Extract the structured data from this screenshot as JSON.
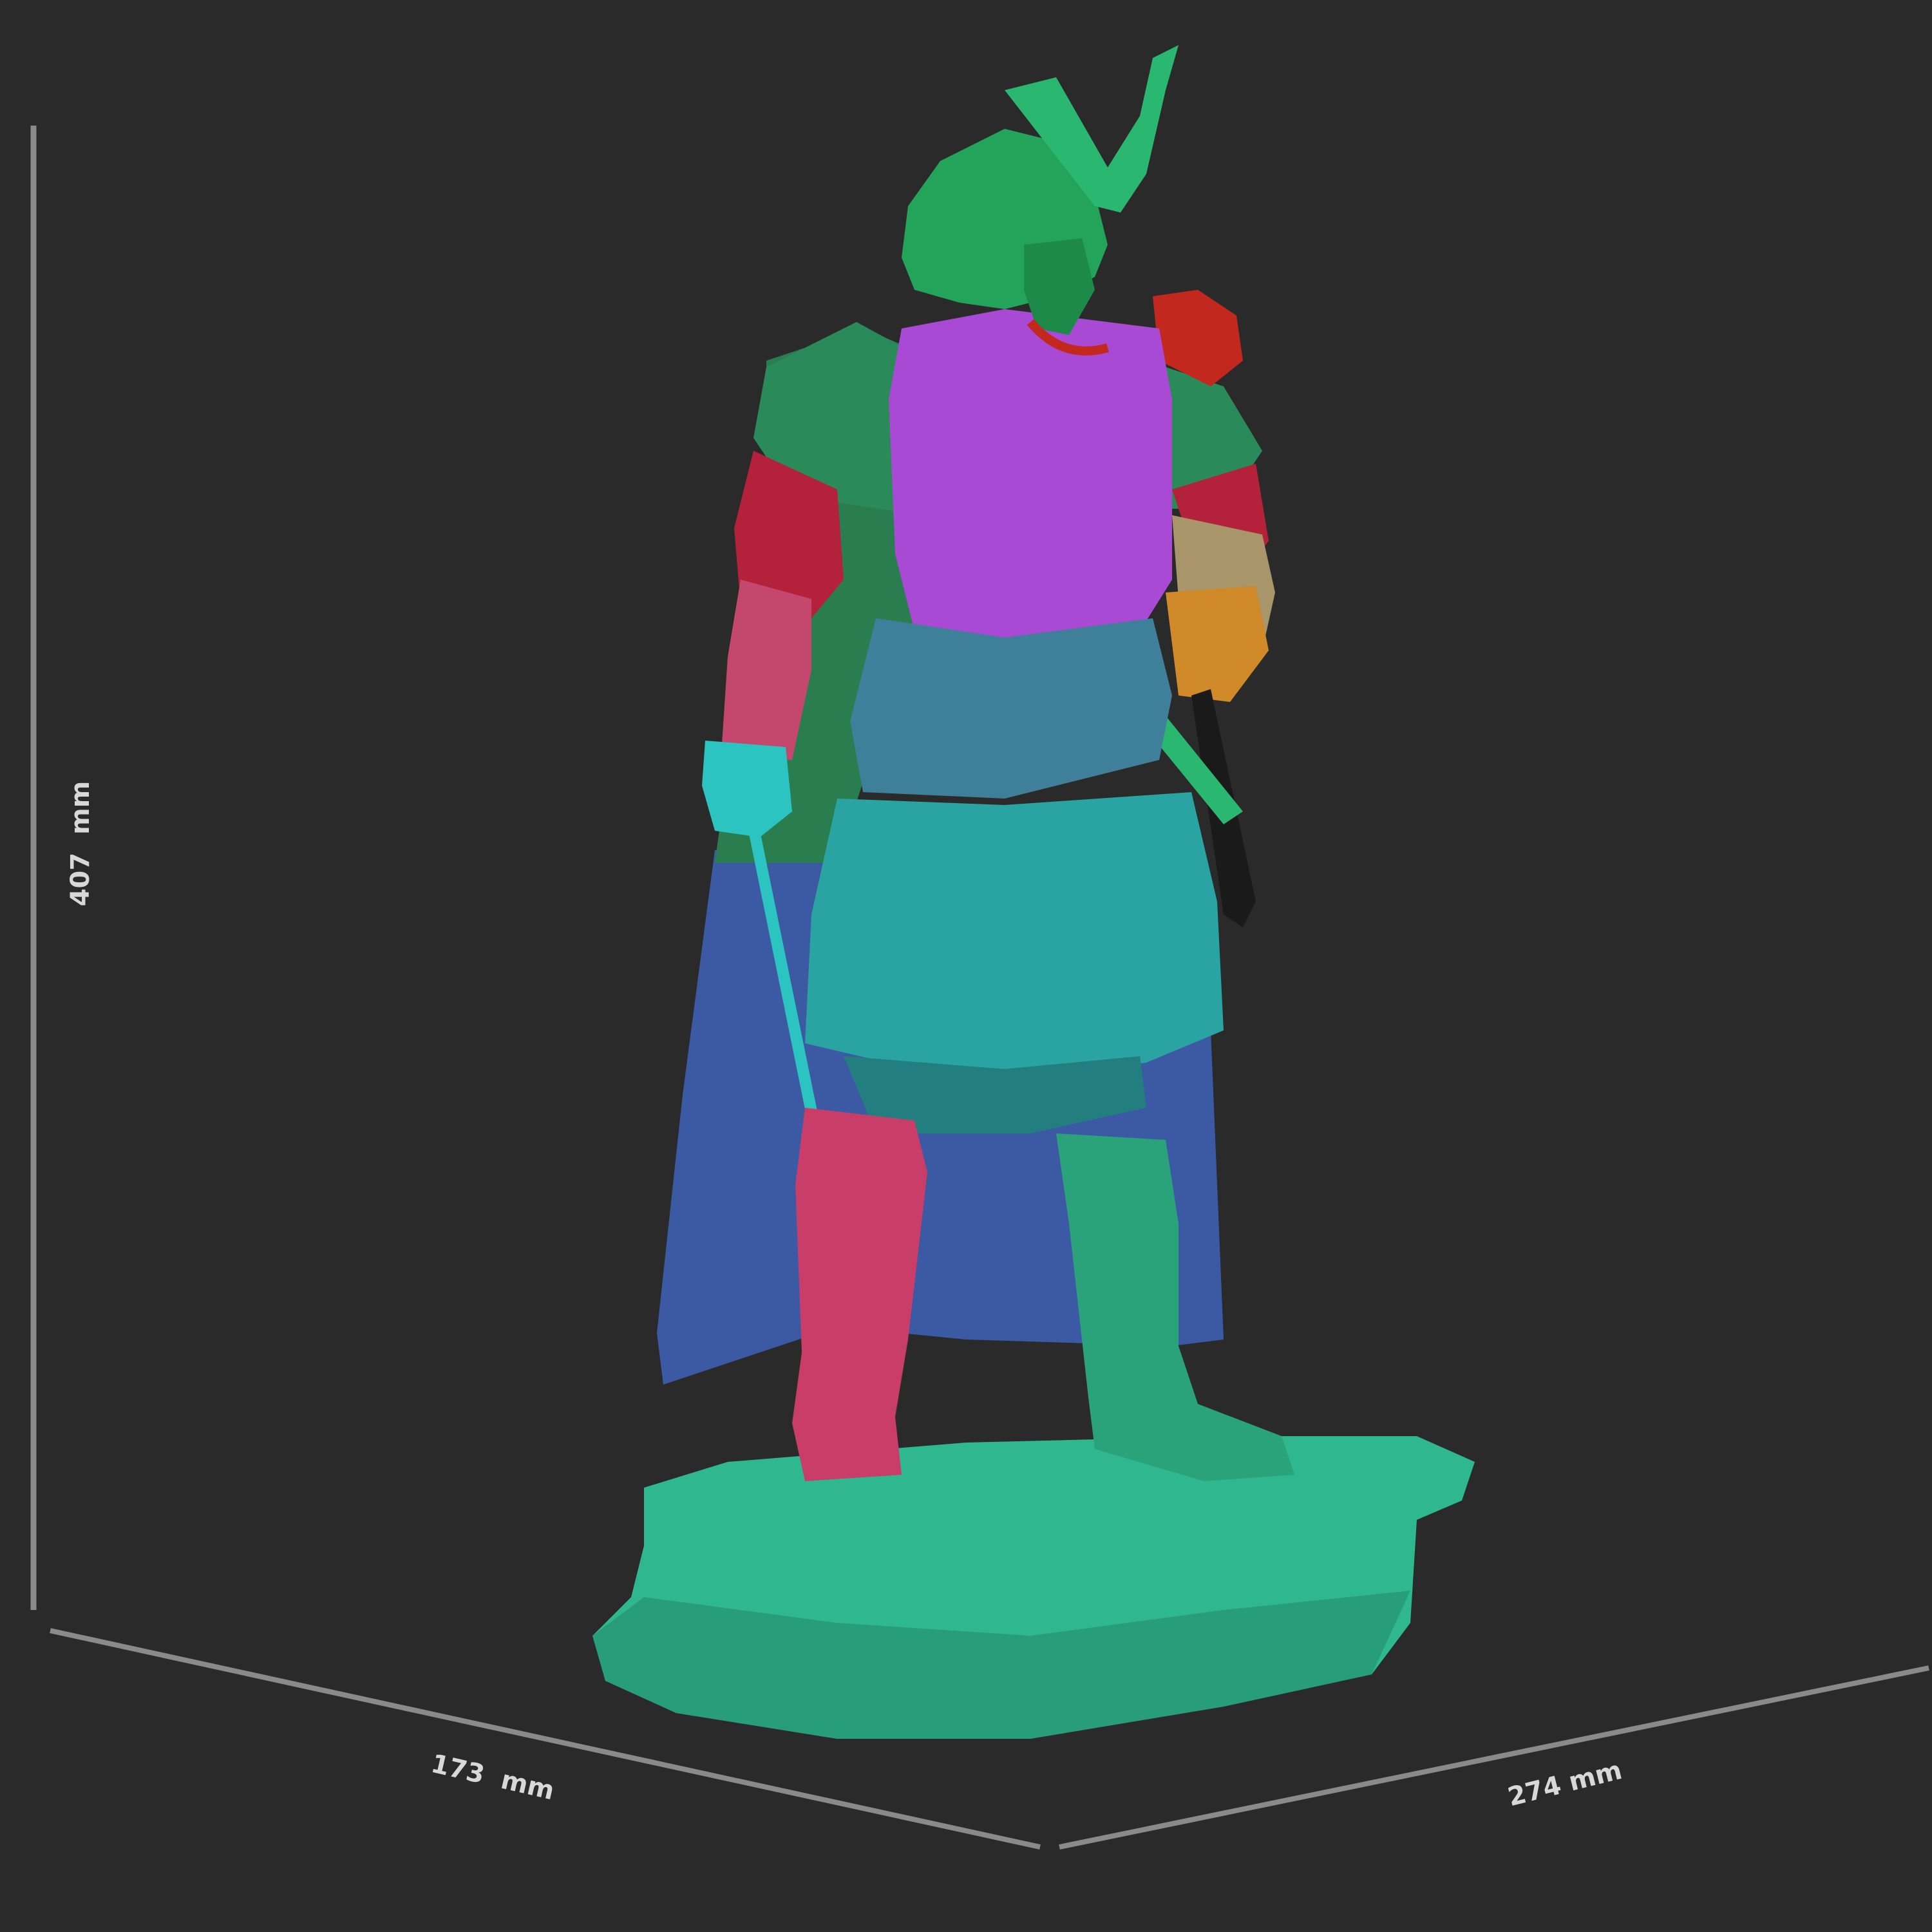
{
  "dimensions": {
    "height": "407  mm",
    "depth": "173  mm",
    "width": "274 mm"
  },
  "colors": {
    "background": "#2a2a2a",
    "guide_line": "#8a8a8a",
    "helmet": "#24a35a",
    "chest": "#a94ad4",
    "cape_upper": "#2a7d4f",
    "cape_lower": "#3c5aa3",
    "shoulder_red": "#b3223a",
    "arm_pink": "#c4486e",
    "glove_cyan": "#2cc4c0",
    "belt_blue": "#3e7f99",
    "skirt_teal": "#2aa3a3",
    "leg_left_pink": "#c93e68",
    "leg_right_green": "#2aa37a",
    "base_teal": "#2fb88f",
    "sheath_dark": "#1a1a1a",
    "hilt_orange": "#d08a2a"
  }
}
